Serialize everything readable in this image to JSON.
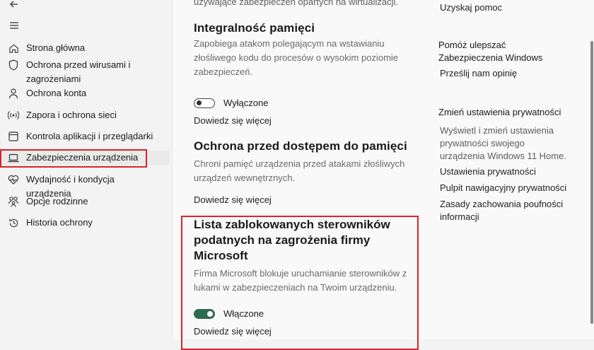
{
  "sidebar": {
    "items": [
      {
        "label": "Strona główna",
        "icon": "home-icon"
      },
      {
        "label": "Ochrona przed wirusami i zagrożeniami",
        "icon": "shield-icon"
      },
      {
        "label": "Ochrona konta",
        "icon": "person-icon"
      },
      {
        "label": "Zapora i ochrona sieci",
        "icon": "antenna-icon"
      },
      {
        "label": "Kontrola aplikacji i przeglądarki",
        "icon": "app-browser-icon"
      },
      {
        "label": "Zabezpieczenia urządzenia",
        "icon": "laptop-icon"
      },
      {
        "label": "Wydajność i kondycja urządzenia",
        "icon": "heart-pulse-icon"
      },
      {
        "label": "Opcje rodzinne",
        "icon": "family-icon"
      },
      {
        "label": "Historia ochrony",
        "icon": "history-icon"
      }
    ],
    "active_index": 5
  },
  "main": {
    "cut_text": "używające zabezpieczeń opartych na wirtualizacji.",
    "memory_integrity": {
      "title": "Integralność pamięci",
      "description": "Zapobiega atakom polegającym na wstawianiu złośliwego kodu do procesów o wysokim poziomie zabezpieczeń.",
      "toggle_state": "off",
      "toggle_label": "Wyłączone",
      "learn_more": "Dowiedz się więcej"
    },
    "memory_access": {
      "title": "Ochrona przed dostępem do pamięci",
      "description": "Chroni pamięć urządzenia przed atakami złośliwych urządzeń wewnętrznych.",
      "learn_more": "Dowiedz się więcej"
    },
    "driver_blocklist": {
      "title": "Lista zablokowanych sterowników podatnych na zagrożenia firmy Microsoft",
      "description": "Firma Microsoft blokuje uruchamianie sterowników z lukami w zabezpieczeniach na Twoim urządzeniu.",
      "toggle_state": "on",
      "toggle_label": "Włączone",
      "learn_more": "Dowiedz się więcej"
    }
  },
  "right": {
    "get_help": "Uzyskaj pomoc",
    "improve_heading": "Pomóż ulepszać Zabezpieczenia Windows",
    "feedback_link": "Prześlij nam opinię",
    "privacy_heading": "Zmień ustawienia prywatności",
    "privacy_body": "Wyświetl i zmień ustawienia prywatności swojego urządzenia Windows 11 Home.",
    "privacy_links": [
      "Ustawienia prywatności",
      "Pulpit nawigacyjny prywatności",
      "Zasady zachowania poufności informacji"
    ]
  },
  "colors": {
    "accent_toggle": "#2d6b4e",
    "highlight": "#d9222a"
  }
}
